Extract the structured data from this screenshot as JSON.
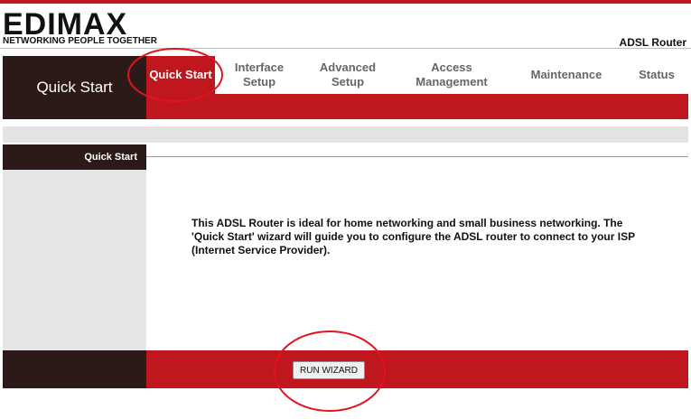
{
  "header": {
    "brand": "EDIMAX",
    "tagline": "NETWORKING PEOPLE TOGETHER",
    "product": "ADSL Router"
  },
  "nav": {
    "section_title": "Quick Start",
    "tabs": [
      {
        "label": "Quick Start",
        "active": true
      },
      {
        "label": "Interface Setup",
        "active": false
      },
      {
        "label": "Advanced Setup",
        "active": false
      },
      {
        "label": "Access Management",
        "active": false
      },
      {
        "label": "Maintenance",
        "active": false
      },
      {
        "label": "Status",
        "active": false
      }
    ]
  },
  "page": {
    "sidebar_heading": "Quick Start",
    "description": "This ADSL Router is ideal for home networking and small business networking. The 'Quick Start' wizard will guide you to configure the ADSL router to connect to your ISP (Internet Service Provider).",
    "run_wizard_label": "RUN WIZARD"
  },
  "colors": {
    "brand_red": "#c0161d",
    "dark_brown": "#2b1a17",
    "annotation_red": "#e0141e"
  }
}
